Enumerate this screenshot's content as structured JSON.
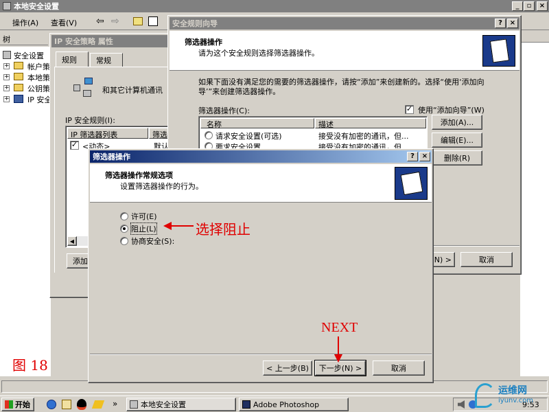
{
  "main_window": {
    "title": "本地安全设置",
    "menu": [
      "操作(A)",
      "查看(V)"
    ],
    "tree_header": "树",
    "tree_items": [
      "安全设置",
      "帐户策",
      "本地策",
      "公钥策",
      "IP 安全"
    ]
  },
  "ipsec_props": {
    "title": "IP 安全策略 属性",
    "tabs": [
      "规则",
      "常规"
    ],
    "description": "和其它计算机通讯",
    "rules_label": "IP 安全规则(I):",
    "columns": [
      "IP 筛选器列表",
      "筛选"
    ],
    "rows": [
      {
        "name": "<动态>",
        "value": "默认"
      }
    ],
    "add_button": "添加"
  },
  "wizard": {
    "title": "安全规则向导",
    "heading": "筛选器操作",
    "subheading": "请为这个安全规则选择筛选器操作。",
    "instructions": "如果下面没有满足您的需要的筛选器操作，请按“添加”来创建新的。选择“使用‘添加向导’”来创建筛选器操作。",
    "list_label": "筛选器操作(C):",
    "use_wizard": "使用“添加向导”(W)",
    "columns": [
      "名称",
      "描述"
    ],
    "rows": [
      {
        "name": "请求安全设置(可选)",
        "desc": "接受没有加密的通讯，但..."
      },
      {
        "name": "要求安全设置",
        "desc": "接受没有加密的通讯，但..."
      }
    ],
    "buttons": {
      "add": "添加(A)...",
      "edit": "编辑(E)...",
      "delete": "删除(R)",
      "next": "N) >",
      "cancel": "取消"
    }
  },
  "filter_dialog": {
    "title": "筛选器操作",
    "heading": "筛选器操作常规选项",
    "subheading": "设置筛选器操作的行为。",
    "options": [
      {
        "label": "许可(E)",
        "selected": false
      },
      {
        "label": "阻止(L)",
        "selected": true
      },
      {
        "label": "协商安全(S):",
        "selected": false
      }
    ],
    "buttons": {
      "back": "< 上一步(B)",
      "next": "下一步(N) >",
      "cancel": "取消"
    }
  },
  "annotations": {
    "select_block": "选择阻止",
    "next": "NEXT",
    "figure": "图 18",
    "accent": "#e00000"
  },
  "taskbar": {
    "start": "开始",
    "tasks": [
      "本地安全设置",
      "Adobe Photoshop"
    ],
    "clock": "9:53"
  },
  "watermark": {
    "text": "运维网",
    "url": "iyunv.com"
  }
}
